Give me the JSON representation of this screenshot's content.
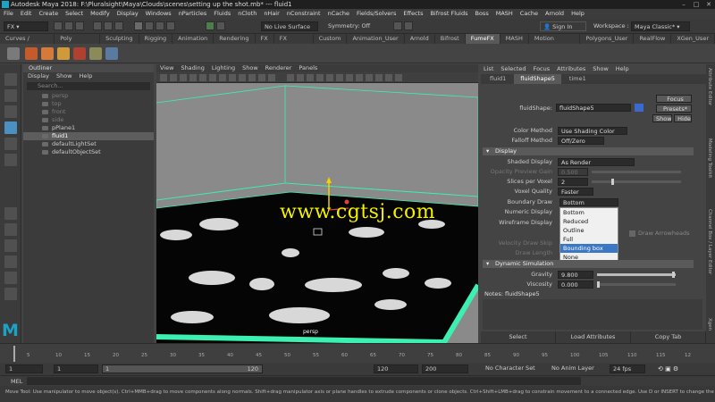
{
  "titlebar": {
    "text": "Autodesk Maya 2018: F:\\Pluralsight\\Maya\\Clouds\\scenes\\setting up the shot.mb*  ---  fluid1"
  },
  "menubar": [
    "File",
    "Edit",
    "Create",
    "Select",
    "Modify",
    "Display",
    "Windows",
    "nParticles",
    "Fluids",
    "nCloth",
    "nHair",
    "nConstraint",
    "nCache",
    "Fields/Solvers",
    "Effects",
    "Bifrost Fluids",
    "Boss",
    "MASH",
    "Cache",
    "Arnold",
    "Help"
  ],
  "statusline": {
    "mode": "FX",
    "live_surface": "No Live Surface",
    "symmetry": "Symmetry: Off",
    "sign_in": "Sign In",
    "workspace_label": "Workspace :",
    "workspace": "Maya Classic*"
  },
  "shelf_tabs": [
    "Curves / Surfaces",
    "Poly Modeling",
    "Sculpting",
    "Rigging",
    "Animation",
    "Rendering",
    "FX",
    "FX Caching",
    "Custom",
    "Animation_User",
    "Arnold",
    "Bifrost",
    "FumeFX",
    "MASH",
    "Motion Graphics",
    "Polygons_User",
    "RealFlow",
    "XGen_User"
  ],
  "shelf_active": "FumeFX",
  "outliner": {
    "title": "Outliner",
    "menu": [
      "Display",
      "Show",
      "Help"
    ],
    "search_placeholder": "Search...",
    "items": [
      {
        "label": "persp",
        "dim": true
      },
      {
        "label": "top",
        "dim": true
      },
      {
        "label": "front",
        "dim": true
      },
      {
        "label": "side",
        "dim": true
      },
      {
        "label": "pPlane1",
        "dim": false
      },
      {
        "label": "fluid1",
        "dim": false,
        "selected": true
      },
      {
        "label": "defaultLightSet",
        "dim": false
      },
      {
        "label": "defaultObjectSet",
        "dim": false
      }
    ]
  },
  "viewport": {
    "menu": [
      "View",
      "Shading",
      "Lighting",
      "Show",
      "Renderer",
      "Panels"
    ],
    "watermark": "www.cgtsj.com",
    "camera": "persp"
  },
  "attribute_editor": {
    "menu": [
      "List",
      "Selected",
      "Focus",
      "Attributes",
      "Show",
      "Help"
    ],
    "tabs": [
      "fluid1",
      "fluidShape5",
      "time1"
    ],
    "active_tab": "fluidShape5",
    "node_label": "fluidShape:",
    "node_value": "fluidShape5",
    "focus": "Focus",
    "presets": "Presets*",
    "show": "Show",
    "hide": "Hide",
    "color_method_label": "Color Method",
    "color_method": "Use Shading Color",
    "falloff_label": "Falloff Method",
    "falloff": "Off/Zero",
    "display_section": "Display",
    "shaded_display_label": "Shaded Display",
    "shaded_display": "As Render",
    "opacity_gain_label": "Opacity Preview Gain",
    "opacity_gain": "0.500",
    "slices_label": "Slices per Voxel",
    "slices": "2",
    "voxel_quality_label": "Voxel Quality",
    "voxel_quality": "Faster",
    "boundary_draw_label": "Boundary Draw",
    "boundary_draw": "Bottom",
    "numeric_display_label": "Numeric Display",
    "wireframe_display_label": "Wireframe Display",
    "velocity_draw_label": "Velocity Draw Skip",
    "draw_length_label": "Draw Length",
    "draw_arrowheads": "Draw Arrowheads",
    "dropdown_options": [
      "Bottom",
      "Reduced",
      "Outline",
      "Full",
      "Bounding box",
      "None"
    ],
    "dropdown_highlight": 4,
    "dynamic_section": "Dynamic Simulation",
    "gravity_label": "Gravity",
    "gravity": "9.800",
    "viscosity_label": "Viscosity",
    "viscosity": "0.000",
    "notes_label": "Notes:  fluidShape5",
    "bottom_buttons": [
      "Select",
      "Load Attributes",
      "Copy Tab"
    ]
  },
  "right_tabs": [
    "Attribute Editor",
    "Modeling Toolkit",
    "Channel Box / Layer Editor",
    "Xgen"
  ],
  "timeslider": {
    "ticks": [
      "5",
      "10",
      "15",
      "20",
      "25",
      "30",
      "35",
      "40",
      "45",
      "50",
      "55",
      "60",
      "65",
      "70",
      "75",
      "80",
      "85",
      "90",
      "95",
      "100",
      "105",
      "110",
      "115",
      "12"
    ],
    "current": "1"
  },
  "rangebar": {
    "start": "1",
    "start2": "1",
    "range_start": "1",
    "range_end": "120",
    "end": "120",
    "end2": "200",
    "character_set": "No Character Set",
    "anim_layer": "No Anim Layer",
    "fps": "24 fps"
  },
  "melbar": {
    "label": "MEL"
  },
  "helpline": "Move Tool: Use manipulator to move object(s). Ctrl+MMB+drag to move components along normals. Shift+drag manipulator axis or plane handles to extrude components or clone objects. Ctrl+Shift+LMB+drag to constrain movement to a connected edge. Use D or INSERT to change the pivot position and axis orientatio",
  "colors": {
    "accent": "#1aa3c4",
    "selection": "#3a78c5",
    "wire": "#3bf0b0",
    "watermark": "#f5f000"
  }
}
